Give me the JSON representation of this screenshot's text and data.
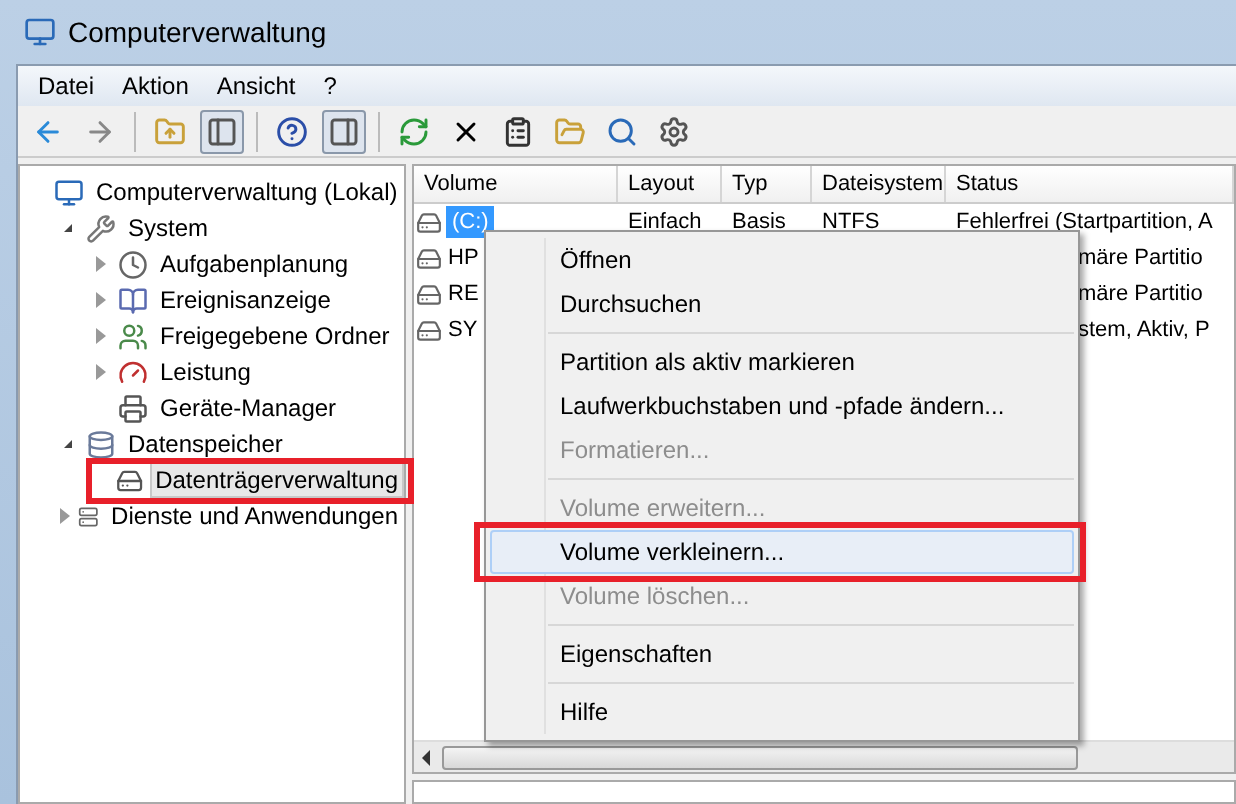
{
  "window": {
    "title": "Computerverwaltung"
  },
  "menu_bar": [
    "Datei",
    "Aktion",
    "Ansicht",
    "?"
  ],
  "toolbar": [
    {
      "kind": "back"
    },
    {
      "kind": "forward"
    },
    {
      "kind": "separator"
    },
    {
      "kind": "up"
    },
    {
      "kind": "tree_toggle",
      "selected": true
    },
    {
      "kind": "separator"
    },
    {
      "kind": "help"
    },
    {
      "kind": "action_pane",
      "selected": true
    },
    {
      "kind": "separator"
    },
    {
      "kind": "refresh"
    },
    {
      "kind": "delete"
    },
    {
      "kind": "properties"
    },
    {
      "kind": "open"
    },
    {
      "kind": "find"
    },
    {
      "kind": "settings"
    }
  ],
  "tree": {
    "label": "Computerverwaltung (Lokal)",
    "children": [
      {
        "label": "System",
        "expanded": true,
        "children": [
          {
            "label": "Aufgabenplanung",
            "expanded": false
          },
          {
            "label": "Ereignisanzeige",
            "expanded": false
          },
          {
            "label": "Freigegebene Ordner",
            "expanded": false
          },
          {
            "label": "Leistung",
            "expanded": false
          },
          {
            "label": "Geräte-Manager"
          }
        ]
      },
      {
        "label": "Datenspeicher",
        "expanded": true,
        "children": [
          {
            "label": "Datenträgerverwaltung",
            "selected": true
          }
        ]
      },
      {
        "label": "Dienste und Anwendungen",
        "expanded": false
      }
    ]
  },
  "table": {
    "columns": [
      "Volume",
      "Layout",
      "Typ",
      "Dateisystem",
      "Status"
    ],
    "rows": [
      {
        "volume": "(C:)",
        "layout": "Einfach",
        "type": "Basis",
        "filesystem": "NTFS",
        "status": "Fehlerfrei (Startpartition, A",
        "selected": true
      },
      {
        "volume": "HP",
        "status": "märe Partitio",
        "selected": false
      },
      {
        "volume": "RE",
        "status": "märe Partitio",
        "selected": false
      },
      {
        "volume": "SY",
        "status": "stem, Aktiv, P",
        "selected": false
      }
    ]
  },
  "context_menu": [
    {
      "kind": "item",
      "label": "Öffnen",
      "disabled": false,
      "selected": false
    },
    {
      "kind": "item",
      "label": "Durchsuchen",
      "disabled": false,
      "selected": false
    },
    {
      "kind": "separator"
    },
    {
      "kind": "item",
      "label": "Partition als aktiv markieren",
      "disabled": false,
      "selected": false
    },
    {
      "kind": "item",
      "label": "Laufwerkbuchstaben und -pfade ändern...",
      "disabled": false,
      "selected": false
    },
    {
      "kind": "item",
      "label": "Formatieren...",
      "disabled": true,
      "selected": false
    },
    {
      "kind": "separator"
    },
    {
      "kind": "item",
      "label": "Volume erweitern...",
      "disabled": true,
      "selected": false
    },
    {
      "kind": "item",
      "label": "Volume verkleinern...",
      "disabled": false,
      "selected": true
    },
    {
      "kind": "item",
      "label": "Volume löschen...",
      "disabled": true,
      "selected": false
    },
    {
      "kind": "separator"
    },
    {
      "kind": "item",
      "label": "Eigenschaften",
      "disabled": false,
      "selected": false
    },
    {
      "kind": "separator"
    },
    {
      "kind": "item",
      "label": "Hilfe",
      "disabled": false,
      "selected": false
    }
  ]
}
